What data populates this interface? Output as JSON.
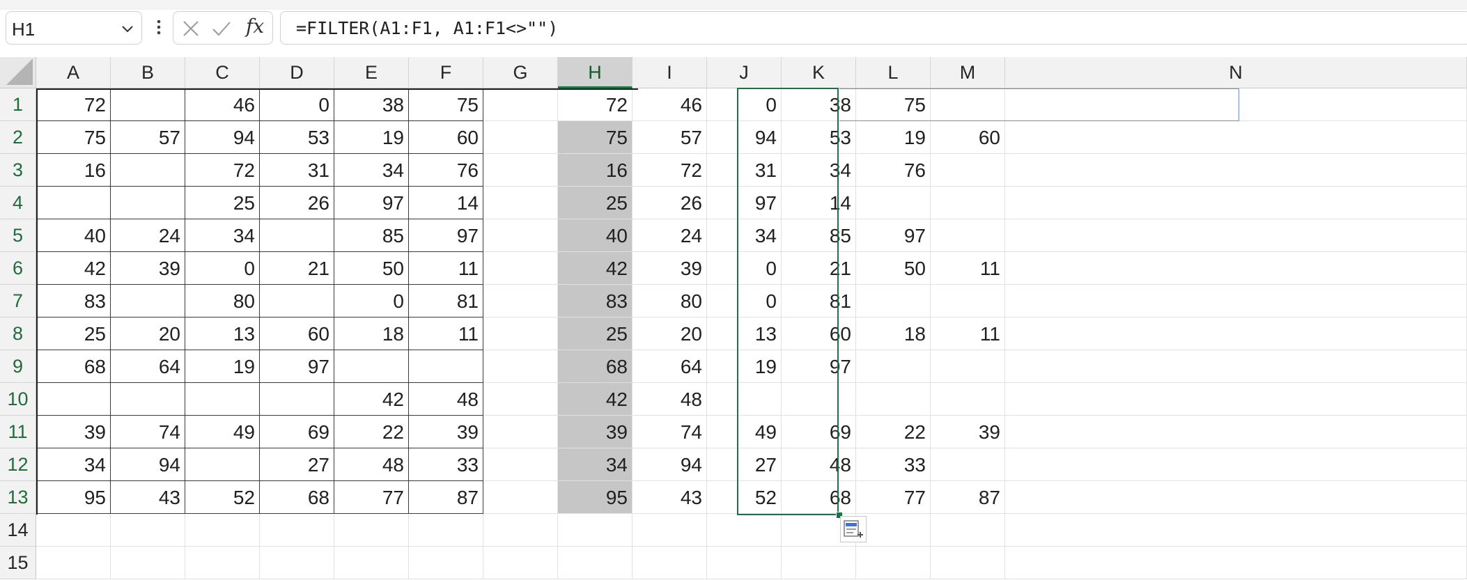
{
  "name_box": {
    "value": "H1"
  },
  "formula_bar": {
    "formula": "=FILTER(A1:F1, A1:F1<>\"\")"
  },
  "columns": [
    "A",
    "B",
    "C",
    "D",
    "E",
    "F",
    "G",
    "H",
    "I",
    "J",
    "K",
    "L",
    "M",
    "N"
  ],
  "selected_column": "H",
  "rows": [
    "1",
    "2",
    "3",
    "4",
    "5",
    "6",
    "7",
    "8",
    "9",
    "10",
    "11",
    "12",
    "13",
    "14",
    "15"
  ],
  "active_cell": "H1",
  "selection": "H1:H13",
  "source_table": {
    "range": "A1:F13",
    "rows": [
      [
        "72",
        "",
        "46",
        "0",
        "38",
        "75"
      ],
      [
        "75",
        "57",
        "94",
        "53",
        "19",
        "60"
      ],
      [
        "16",
        "",
        "72",
        "31",
        "34",
        "76"
      ],
      [
        "",
        "",
        "25",
        "26",
        "97",
        "14"
      ],
      [
        "40",
        "24",
        "34",
        "",
        "85",
        "97"
      ],
      [
        "42",
        "39",
        "0",
        "21",
        "50",
        "11"
      ],
      [
        "83",
        "",
        "80",
        "",
        "0",
        "81"
      ],
      [
        "25",
        "20",
        "13",
        "60",
        "18",
        "11"
      ],
      [
        "68",
        "64",
        "19",
        "97",
        "",
        ""
      ],
      [
        "",
        "",
        "",
        "",
        "42",
        "48"
      ],
      [
        "39",
        "74",
        "49",
        "69",
        "22",
        "39"
      ],
      [
        "34",
        "94",
        "",
        "27",
        "48",
        "33"
      ],
      [
        "95",
        "43",
        "52",
        "68",
        "77",
        "87"
      ]
    ]
  },
  "result_table": {
    "range": "H1:M13",
    "rows": [
      [
        "72",
        "46",
        "0",
        "38",
        "75",
        ""
      ],
      [
        "75",
        "57",
        "94",
        "53",
        "19",
        "60"
      ],
      [
        "16",
        "72",
        "31",
        "34",
        "76",
        ""
      ],
      [
        "25",
        "26",
        "97",
        "14",
        "",
        ""
      ],
      [
        "40",
        "24",
        "34",
        "85",
        "97",
        ""
      ],
      [
        "42",
        "39",
        "0",
        "21",
        "50",
        "11"
      ],
      [
        "83",
        "80",
        "0",
        "81",
        "",
        ""
      ],
      [
        "25",
        "20",
        "13",
        "60",
        "18",
        "11"
      ],
      [
        "68",
        "64",
        "19",
        "97",
        "",
        ""
      ],
      [
        "42",
        "48",
        "",
        "",
        "",
        ""
      ],
      [
        "39",
        "74",
        "49",
        "69",
        "22",
        "39"
      ],
      [
        "34",
        "94",
        "27",
        "48",
        "33",
        ""
      ],
      [
        "95",
        "43",
        "52",
        "68",
        "77",
        "87"
      ]
    ]
  },
  "icons": {
    "name_box_dropdown": "chevron-down-icon",
    "more": "more-vertical-icon",
    "cancel": "close-icon",
    "enter": "checkmark-icon",
    "insert_function": "function-icon",
    "paste_options": "paste-options-icon",
    "select_all": "select-all-icon"
  },
  "insert_function_label": "fx",
  "colors": {
    "selection": "#1e7145",
    "selected_fill": "#c6c6c6",
    "spill_border": "#6f8fc9"
  }
}
